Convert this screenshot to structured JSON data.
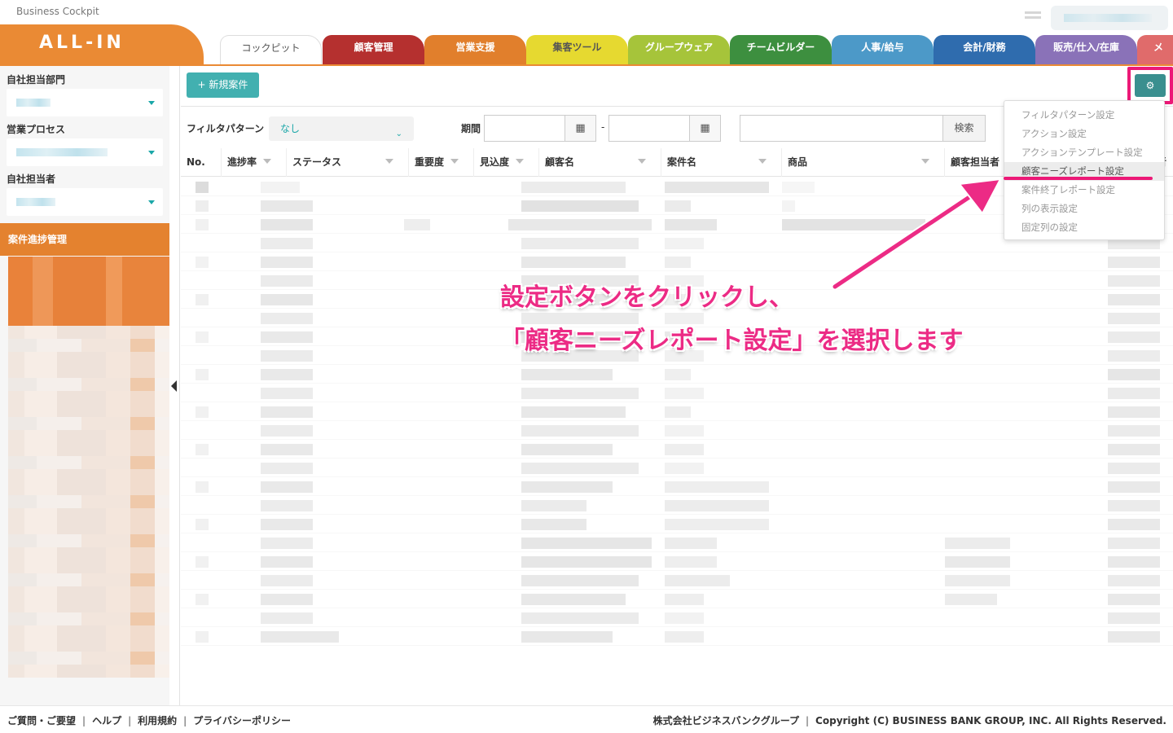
{
  "app": {
    "name": "Business Cockpit",
    "logo": "ALL-IN"
  },
  "tabs": [
    {
      "label": "コックピット",
      "color": "#ffffff"
    },
    {
      "label": "顧客管理",
      "color": "#b5302f"
    },
    {
      "label": "営業支援",
      "color": "#e17f2c"
    },
    {
      "label": "集客ツール",
      "color": "#e6d930"
    },
    {
      "label": "グループウェア",
      "color": "#a6c43a"
    },
    {
      "label": "チームビルダー",
      "color": "#3d8f3f"
    },
    {
      "label": "人事/給与",
      "color": "#4c99c8"
    },
    {
      "label": "会計/財務",
      "color": "#2f6cae"
    },
    {
      "label": "販売/仕入/在庫",
      "color": "#8a72b8"
    },
    {
      "label": "メ",
      "color": "#e06b6b"
    }
  ],
  "sidebar": {
    "dept_label": "自社担当部門",
    "process_label": "営業プロセス",
    "person_label": "自社担当者",
    "section_title": "案件進捗管理"
  },
  "toolbar": {
    "new_button": "新規案件",
    "settings_icon": "gear-icon"
  },
  "filters": {
    "pattern_label": "フィルタパターン",
    "pattern_value": "なし",
    "period_label": "期間",
    "date_sep": "-",
    "search_button": "検索"
  },
  "table": {
    "columns": [
      "No.",
      "進捗率",
      "ステータス",
      "重要度",
      "見込度",
      "顧客名",
      "案件名",
      "商品",
      "顧客担当者",
      "者"
    ]
  },
  "settings_menu": {
    "items": [
      "フィルタパターン設定",
      "アクション設定",
      "アクションテンプレート設定",
      "顧客ニーズレポート設定",
      "案件終了レポート設定",
      "列の表示設定",
      "固定列の設定"
    ],
    "highlighted": "顧客ニーズレポート設定"
  },
  "annotation": {
    "line1": "設定ボタンをクリックし、",
    "line2": "「顧客ニーズレポート設定」を選択します",
    "color": "#ec2b85"
  },
  "footer": {
    "links": [
      "ご質問・ご要望",
      "ヘルプ",
      "利用規約",
      "プライバシーポリシー"
    ],
    "company": "株式会社ビジネスバンクグループ",
    "copyright": "Copyright (C) BUSINESS BANK GROUP, INC. All Rights Reserved."
  }
}
